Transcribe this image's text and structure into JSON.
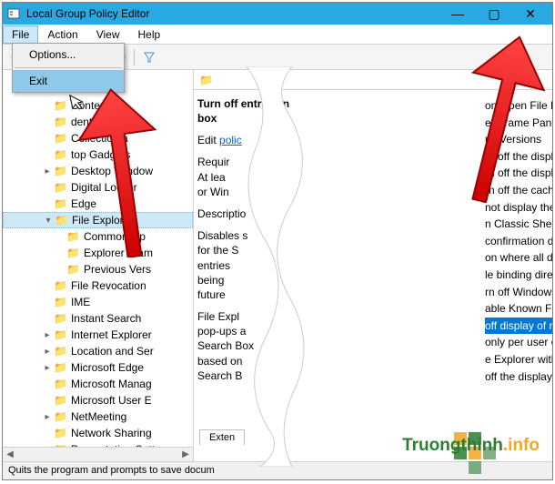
{
  "window": {
    "title": "Local Group Policy Editor",
    "minimize": "—",
    "maximize": "▢",
    "close": "✕"
  },
  "menubar": {
    "file": "File",
    "action": "Action",
    "view": "View",
    "help": "Help"
  },
  "dropdown": {
    "options": "Options...",
    "exit": "Exit"
  },
  "tree": {
    "items": [
      {
        "indent": 3,
        "tw": "",
        "label": "Content"
      },
      {
        "indent": 3,
        "tw": "",
        "label": "dential User In"
      },
      {
        "indent": 3,
        "tw": "",
        "label": "Collection a"
      },
      {
        "indent": 3,
        "tw": "",
        "label": "top Gadgets"
      },
      {
        "indent": 3,
        "tw": ">",
        "label": "Desktop Window"
      },
      {
        "indent": 3,
        "tw": "",
        "label": "Digital Locker"
      },
      {
        "indent": 3,
        "tw": "",
        "label": "Edge"
      },
      {
        "indent": 3,
        "tw": "v",
        "label": "File Explorer",
        "sel": true
      },
      {
        "indent": 4,
        "tw": "",
        "label": "Common Op"
      },
      {
        "indent": 4,
        "tw": "",
        "label": "Explorer Fram"
      },
      {
        "indent": 4,
        "tw": "",
        "label": "Previous Vers"
      },
      {
        "indent": 3,
        "tw": "",
        "label": "File Revocation"
      },
      {
        "indent": 3,
        "tw": "",
        "label": "IME"
      },
      {
        "indent": 3,
        "tw": "",
        "label": "Instant Search"
      },
      {
        "indent": 3,
        "tw": ">",
        "label": "Internet Explorer"
      },
      {
        "indent": 3,
        "tw": ">",
        "label": "Location and Ser"
      },
      {
        "indent": 3,
        "tw": ">",
        "label": "Microsoft Edge"
      },
      {
        "indent": 3,
        "tw": "",
        "label": "Microsoft Manag"
      },
      {
        "indent": 3,
        "tw": "",
        "label": "Microsoft User E"
      },
      {
        "indent": 3,
        "tw": ">",
        "label": "NetMeeting"
      },
      {
        "indent": 3,
        "tw": "",
        "label": "Network Sharing"
      },
      {
        "indent": 3,
        "tw": "",
        "label": "Presentation Sett"
      }
    ]
  },
  "left_detail": {
    "heading": "Turn off entries in box",
    "edit_label": "Edit",
    "edit_link": "polic",
    "req1": "Requir",
    "req2": "At lea",
    "req3": "or Win",
    "desc_label": "Descriptio",
    "disables": "Disables s",
    "for_the": "for the S",
    "entries": "entries",
    "being": "being",
    "future": "future",
    "fe1": "File Expl",
    "fe2": "pop-ups a",
    "fe3": "Search Box",
    "fe4": "based on",
    "fe5": "Search B"
  },
  "right_list": {
    "items": [
      "on Open File Dialog",
      "er Frame Pane",
      "us Versions",
      "rn off the display of thumbnails and only display i",
      "rn off the display of thumbnails and only display i",
      "rn off the caching of thumbnails in hidden thumb",
      "not display the Welcome Center at user logon",
      "n Classic Shell",
      "confirmation dialog when deleting files",
      "on where all default Library definition files for t",
      "le binding directly to IPropertyStoreSet without",
      "rn off Windows Libraries features that rely on inde",
      "able Known Folders",
      "off display of recent search entries in the File Ex",
      "only per user or approved shell extensions",
      "e Explorer with ribbon minimized",
      "off the display of snippets in Content view mod"
    ],
    "selected_index": 13
  },
  "tabs": {
    "extended": "Exten"
  },
  "statusbar": {
    "text": "Quits the program and prompts to save docum"
  },
  "watermark": {
    "prefix": "Truongthinh",
    "suffix": ".info"
  }
}
